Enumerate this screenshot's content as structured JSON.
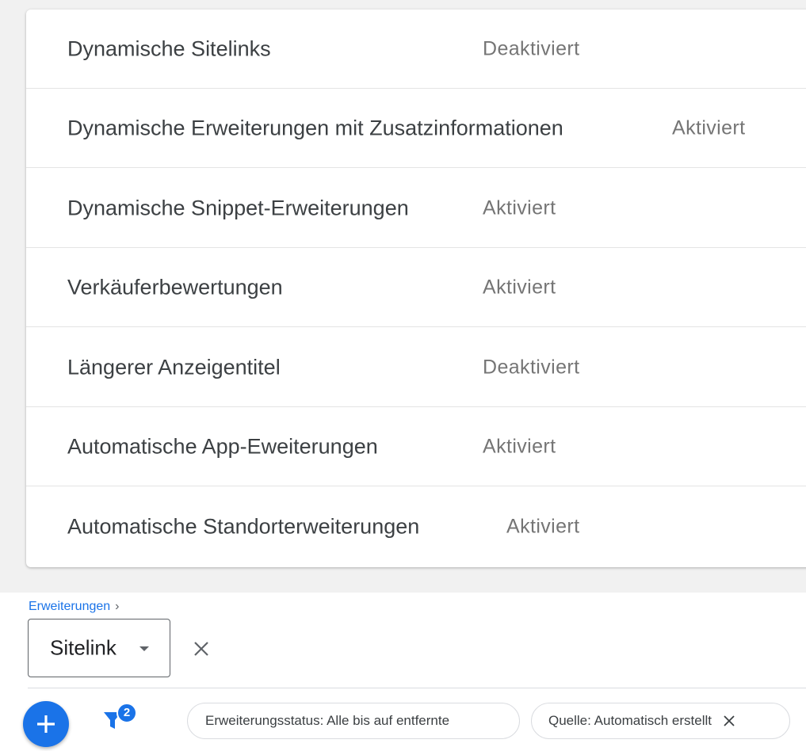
{
  "extensions_list": [
    {
      "name": "Dynamische Sitelinks",
      "status": "Deaktiviert"
    },
    {
      "name": "Dynamische Erweiterungen mit Zusatzinformationen",
      "status": "Aktiviert"
    },
    {
      "name": "Dynamische Snippet-Erweiterungen",
      "status": "Aktiviert"
    },
    {
      "name": "Verkäuferbewertungen",
      "status": "Aktiviert"
    },
    {
      "name": "Längerer Anzeigentitel",
      "status": "Deaktiviert"
    },
    {
      "name": "Automatische App-Eweiterungen",
      "status": "Aktiviert"
    },
    {
      "name": "Automatische Standorterweiterungen",
      "status": "Aktiviert"
    }
  ],
  "breadcrumb": {
    "label": "Erweiterungen",
    "separator": "›"
  },
  "type_select": {
    "value": "Sitelink"
  },
  "toolbar": {
    "add_icon": "plus-icon",
    "filter_icon": "filter-icon",
    "filter_count": "2",
    "chips": [
      {
        "label": "Erweiterungsstatus: Alle bis auf entfernte"
      },
      {
        "label": "Quelle: Automatisch erstellt"
      }
    ]
  },
  "colors": {
    "accent": "#1a73e8",
    "text": "#3c4043",
    "status": "#757575"
  }
}
